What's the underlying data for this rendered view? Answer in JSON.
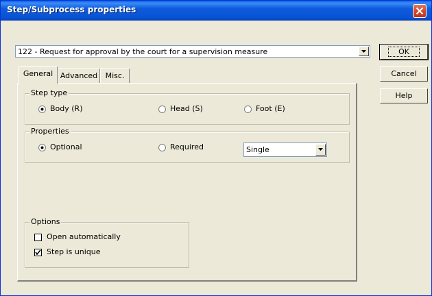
{
  "window": {
    "title": "Step/Subprocess properties"
  },
  "step_select": {
    "value": "122 - Request for approval by the court for a supervision measure"
  },
  "buttons": {
    "ok": "OK",
    "cancel": "Cancel",
    "help": "Help"
  },
  "tabs": [
    {
      "label": "General",
      "active": true
    },
    {
      "label": "Advanced",
      "active": false
    },
    {
      "label": "Misc.",
      "active": false
    }
  ],
  "step_type": {
    "label": "Step type",
    "options": [
      {
        "label": "Body (R)",
        "selected": true
      },
      {
        "label": "Head (S)",
        "selected": false
      },
      {
        "label": "Foot (E)",
        "selected": false
      }
    ]
  },
  "properties": {
    "label": "Properties",
    "options": [
      {
        "label": "Optional",
        "selected": true
      },
      {
        "label": "Required",
        "selected": false
      }
    ],
    "mode_select": {
      "value": "Single"
    }
  },
  "options_group": {
    "label": "Options",
    "checkboxes": [
      {
        "label": "Open automatically",
        "checked": false
      },
      {
        "label": "Step is unique",
        "checked": true
      }
    ]
  },
  "icons": {
    "close": "close-icon",
    "dropdown": "chevron-down-icon",
    "check": "check-icon"
  },
  "colors": {
    "titlebar": "#0653d6",
    "close_button": "#d24a2c",
    "dialog_bg": "#ece9d8"
  }
}
